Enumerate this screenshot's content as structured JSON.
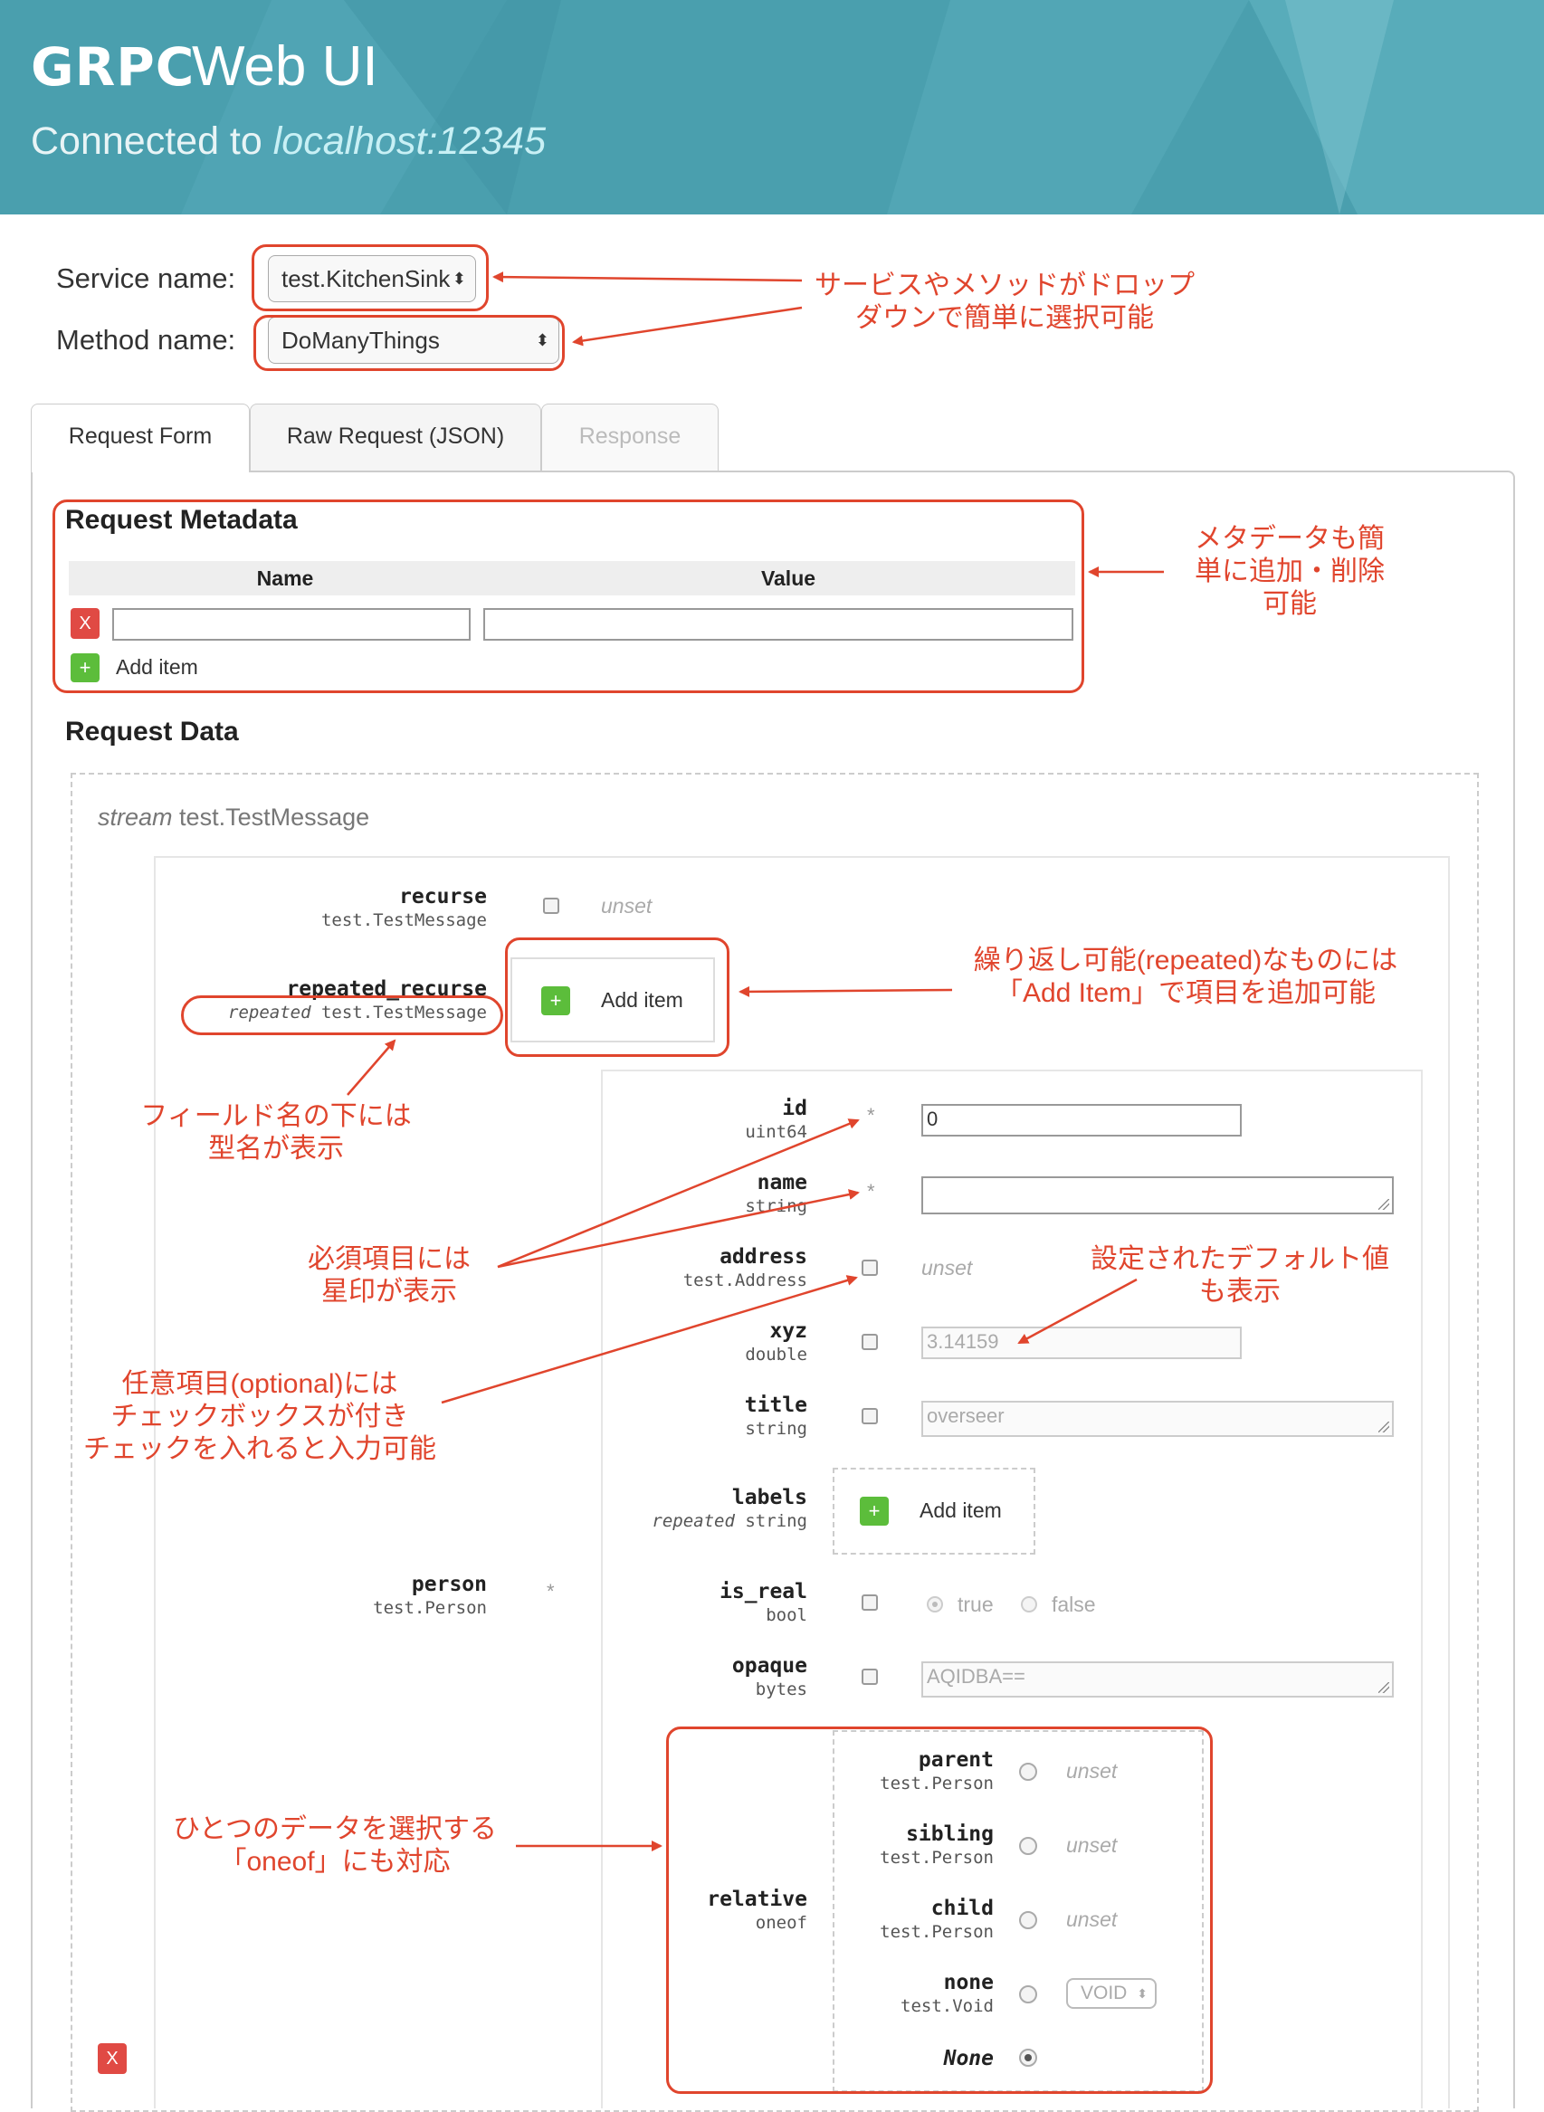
{
  "header": {
    "logo": "GRPC",
    "title": "Web UI",
    "connected_prefix": "Connected to",
    "host": "localhost:12345"
  },
  "selectors": {
    "service_label": "Service name:",
    "service_value": "test.KitchenSink",
    "method_label": "Method name:",
    "method_value": "DoManyThings"
  },
  "tabs": [
    {
      "label": "Request Form",
      "active": true
    },
    {
      "label": "Raw Request (JSON)",
      "active": false
    },
    {
      "label": "Response",
      "active": false,
      "disabled": true
    }
  ],
  "metadata": {
    "heading": "Request Metadata",
    "col_name": "Name",
    "col_value": "Value",
    "remove_label": "X",
    "add_icon": "+",
    "add_label": "Add item"
  },
  "request_data": {
    "heading": "Request Data",
    "stream_kw": "stream",
    "message_type": "test.TestMessage",
    "fields": {
      "recurse": {
        "name": "recurse",
        "type": "test.TestMessage",
        "state": "unset"
      },
      "repeated_recurse": {
        "name": "repeated_recurse",
        "qualifier": "repeated",
        "type": "test.TestMessage",
        "add_label": "Add item"
      },
      "person": {
        "name": "person",
        "type": "test.Person",
        "required_mark": "*"
      }
    },
    "person_fields": {
      "id": {
        "name": "id",
        "type": "uint64",
        "required_mark": "*",
        "value": "0"
      },
      "name": {
        "name": "name",
        "type": "string",
        "required_mark": "*",
        "value": ""
      },
      "address": {
        "name": "address",
        "type": "test.Address",
        "state": "unset"
      },
      "xyz": {
        "name": "xyz",
        "type": "double",
        "placeholder": "3.14159"
      },
      "title": {
        "name": "title",
        "type": "string",
        "placeholder": "overseer"
      },
      "labels": {
        "name": "labels",
        "qualifier": "repeated",
        "type": "string",
        "add_label": "Add item"
      },
      "is_real": {
        "name": "is_real",
        "type": "bool",
        "opt_true": "true",
        "opt_false": "false"
      },
      "opaque": {
        "name": "opaque",
        "type": "bytes",
        "placeholder": "AQIDBA=="
      }
    },
    "relative": {
      "name": "relative",
      "type": "oneof",
      "options": [
        {
          "name": "parent",
          "type": "test.Person",
          "state": "unset"
        },
        {
          "name": "sibling",
          "type": "test.Person",
          "state": "unset"
        },
        {
          "name": "child",
          "type": "test.Person",
          "state": "unset"
        },
        {
          "name": "none",
          "type": "test.Void",
          "select_value": "VOID"
        },
        {
          "name": "None",
          "selected": true
        }
      ]
    },
    "remove_label": "X"
  },
  "annotations": {
    "selector_note": [
      "サービスやメソッドがドロップ",
      "ダウンで簡単に選択可能"
    ],
    "metadata_note": [
      "メタデータも簡",
      "単に追加・削除",
      "可能"
    ],
    "repeated_note": [
      "繰り返し可能(repeated)なものには",
      "「Add Item」で項目を追加可能"
    ],
    "type_note": [
      "フィールド名の下には",
      "型名が表示"
    ],
    "required_note": [
      "必須項目には",
      "星印が表示"
    ],
    "default_note": [
      "設定されたデフォルト値",
      "も表示"
    ],
    "optional_note": [
      "任意項目(optional)には",
      "チェックボックスが付き",
      "チェックを入れると入力可能"
    ],
    "oneof_note": [
      "ひとつのデータを選択する",
      "「oneof」にも対応"
    ]
  },
  "colors": {
    "header_bg": "#4a9fae",
    "annotation_red": "#e0452d",
    "add_green": "#5cbd3b",
    "remove_red": "#e04a44"
  }
}
